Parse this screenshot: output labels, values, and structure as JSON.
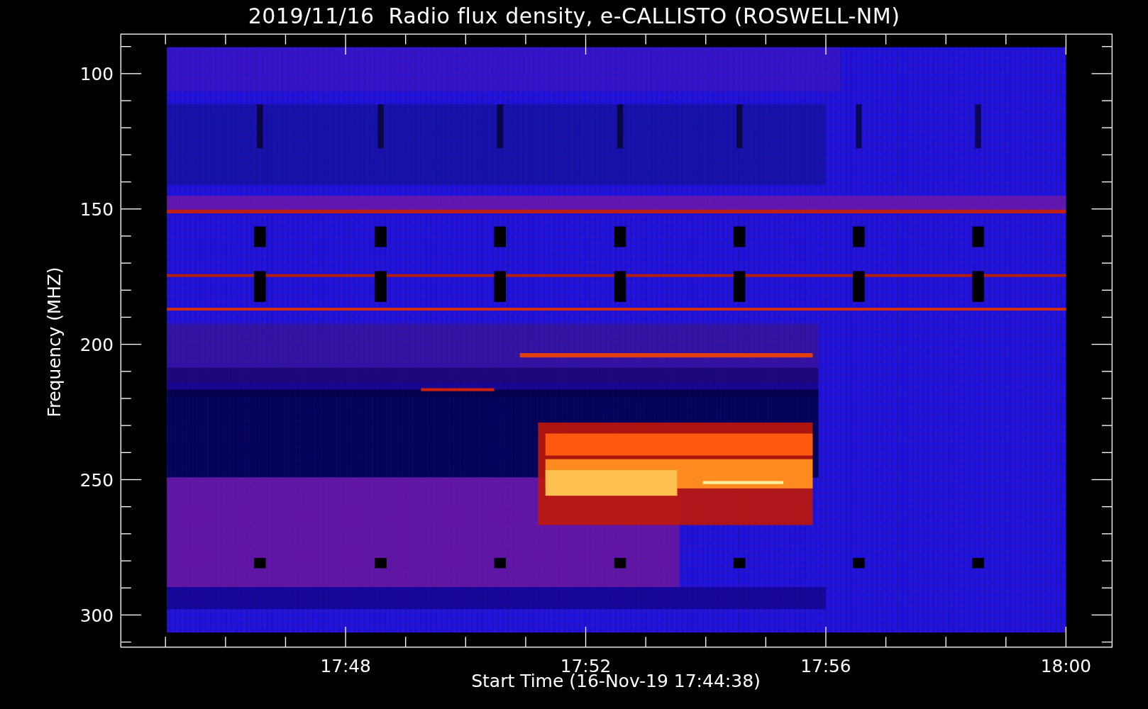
{
  "title": "2019/11/16  Radio flux density, e-CALLISTO (ROSWELL-NM)",
  "y_axis": {
    "label": "Frequency (MHZ)",
    "ticks": [
      "100",
      "150",
      "200",
      "250",
      "300"
    ]
  },
  "x_axis": {
    "label": "Start Time (16-Nov-19 17:44:38)",
    "ticks": [
      "17:48",
      "17:52",
      "17:56",
      "18:00"
    ]
  }
}
